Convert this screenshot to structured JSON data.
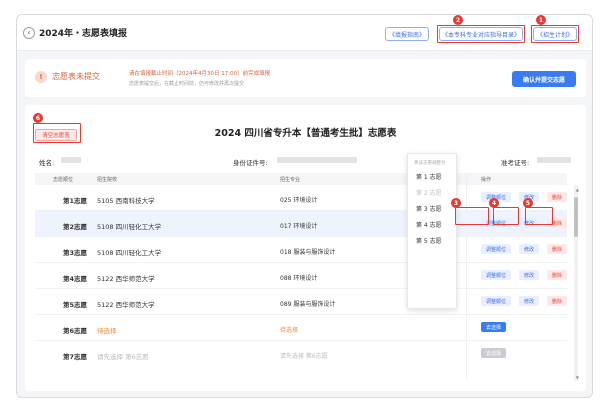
{
  "header": {
    "title": "2024年・志愿表填报",
    "buttons": {
      "fill_guide": "《填报指南》",
      "school_major": "《本专科专业对应指导目录》",
      "enroll_plan": "《招生计划》"
    }
  },
  "alert": {
    "status": "志愿表未提交",
    "deadline": "请在填报截止时间（2024年4月30日 17:00）前完成填报",
    "sub": "志愿表提交后，在截止时间前，仍可修改并再次提交",
    "confirm": "确认并提交志愿"
  },
  "card": {
    "clear_button": "清空志愿表",
    "title": "2024 四川省专升本【普通考生批】志愿表",
    "name_label": "姓名:",
    "id_label": "身份证件号:",
    "ticket_label": "准考证号:"
  },
  "table": {
    "headers": [
      "志愿顺位",
      "招生院校",
      "招生专业",
      "操作"
    ],
    "rows": [
      {
        "order": "第1志愿",
        "school": "5105 西南科技大学",
        "major": "025 环境设计",
        "ops": [
          "调整顺位",
          "修改",
          "删除"
        ]
      },
      {
        "order": "第2志愿",
        "school": "5108 四川轻化工大学",
        "major": "017 环境设计",
        "ops": [
          "调整顺位",
          "修改",
          "删除"
        ]
      },
      {
        "order": "第3志愿",
        "school": "5108 四川轻化工大学",
        "major": "018 服装与服饰设计",
        "ops": [
          "调整顺位",
          "修改",
          "删除"
        ]
      },
      {
        "order": "第4志愿",
        "school": "5122 西华师范大学",
        "major": "088 环境设计",
        "ops": [
          "调整顺位",
          "修改",
          "删除"
        ]
      },
      {
        "order": "第5志愿",
        "school": "5122 西华师范大学",
        "major": "089 服装与服饰设计",
        "ops": [
          "调整顺位",
          "修改",
          "删除"
        ]
      },
      {
        "order": "第6志愿",
        "school": "待选择",
        "major": "待选择",
        "ops": [
          "去选择"
        ]
      },
      {
        "order": "第7志愿",
        "school": "请先选择 第6志愿",
        "major": "请先选择 第6志愿",
        "ops": [
          "去选择"
        ]
      }
    ]
  },
  "popup": {
    "head": "将该志愿调整为",
    "items": [
      "第 1 志愿",
      "第 2 志愿",
      "第 3 志愿",
      "第 4 志愿",
      "第 5 志愿"
    ],
    "disabled_index": 1
  },
  "annotations": [
    "1",
    "2",
    "3",
    "4",
    "5",
    "6"
  ],
  "colors": {
    "accent": "#3a7bf0",
    "danger": "#e04a3b",
    "warning": "#d6613a",
    "annotation": "#e53935"
  }
}
